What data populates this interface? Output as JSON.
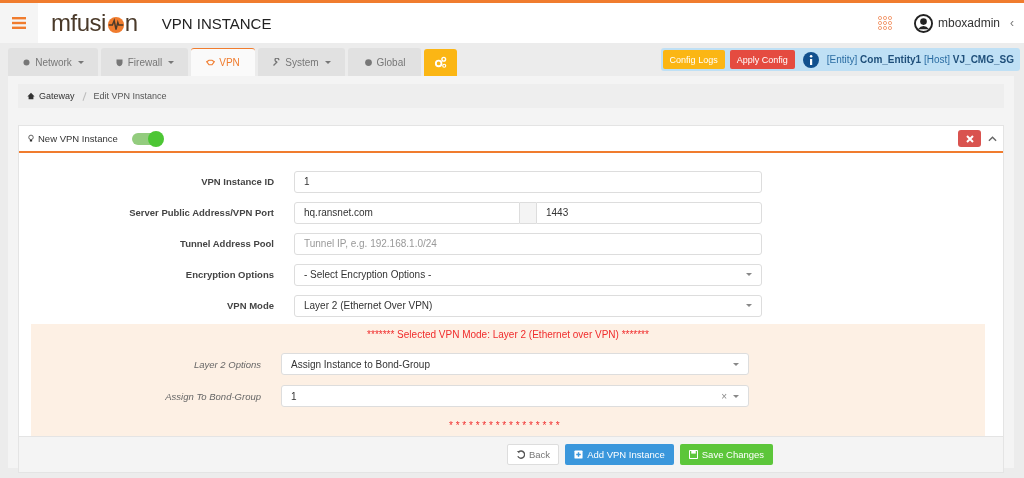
{
  "header": {
    "logo": {
      "text_before_mark": "mfusi",
      "text_after_mark": "n"
    },
    "title": "VPN INSTANCE",
    "user": "mboxadmin",
    "collapse_glyph": "‹"
  },
  "tabs": [
    {
      "label": "Network",
      "dropdown": true,
      "selected": false
    },
    {
      "label": "Firewall",
      "dropdown": true,
      "selected": false
    },
    {
      "label": "VPN",
      "dropdown": false,
      "selected": true
    },
    {
      "label": "System",
      "dropdown": true,
      "selected": false
    },
    {
      "label": "Global",
      "dropdown": false,
      "selected": false
    }
  ],
  "actions": {
    "config_logs": "Config Logs",
    "apply_config": "Apply Config",
    "entity_label": "[Entity]",
    "entity": "Com_Entity1",
    "host_label": "[Host]",
    "host": "VJ_CMG_SG"
  },
  "breadcrumb": [
    "Gateway",
    "Edit VPN Instance"
  ],
  "panel": {
    "title": "New VPN Instance",
    "enabled": true,
    "fields": [
      {
        "label": "VPN Instance ID",
        "kind": "text",
        "value": "1"
      },
      {
        "label": "Server Public Address/VPN Port",
        "kind": "pair",
        "value": "hq.ransnet.com",
        "value_2": "1443"
      },
      {
        "label": "Tunnel Address Pool",
        "kind": "text",
        "placeholder": "Tunnel IP, e.g. 192.168.1.0/24"
      },
      {
        "label": "Encryption Options",
        "kind": "select",
        "value": "- Select Encryption Options -"
      },
      {
        "label": "VPN Mode",
        "kind": "select",
        "value": "Layer 2 (Ethernet Over VPN)"
      }
    ],
    "mode_section": {
      "heading": "******* Selected VPN Mode: Layer 2 (Ethernet over VPN) *******",
      "fields": [
        {
          "label": "Layer 2 Options",
          "kind": "select",
          "value": "Assign Instance to Bond-Group"
        },
        {
          "label": "Assign To Bond-Group",
          "kind": "clearable",
          "value": "1",
          "clear_glyph": "×"
        }
      ],
      "footer": "* * * * * * * * * * * * * * * * *"
    },
    "buttons": [
      {
        "label": "Back",
        "kind": "back"
      },
      {
        "label": "Add VPN Instance",
        "kind": "add"
      },
      {
        "label": "Save Changes",
        "kind": "save"
      }
    ]
  }
}
